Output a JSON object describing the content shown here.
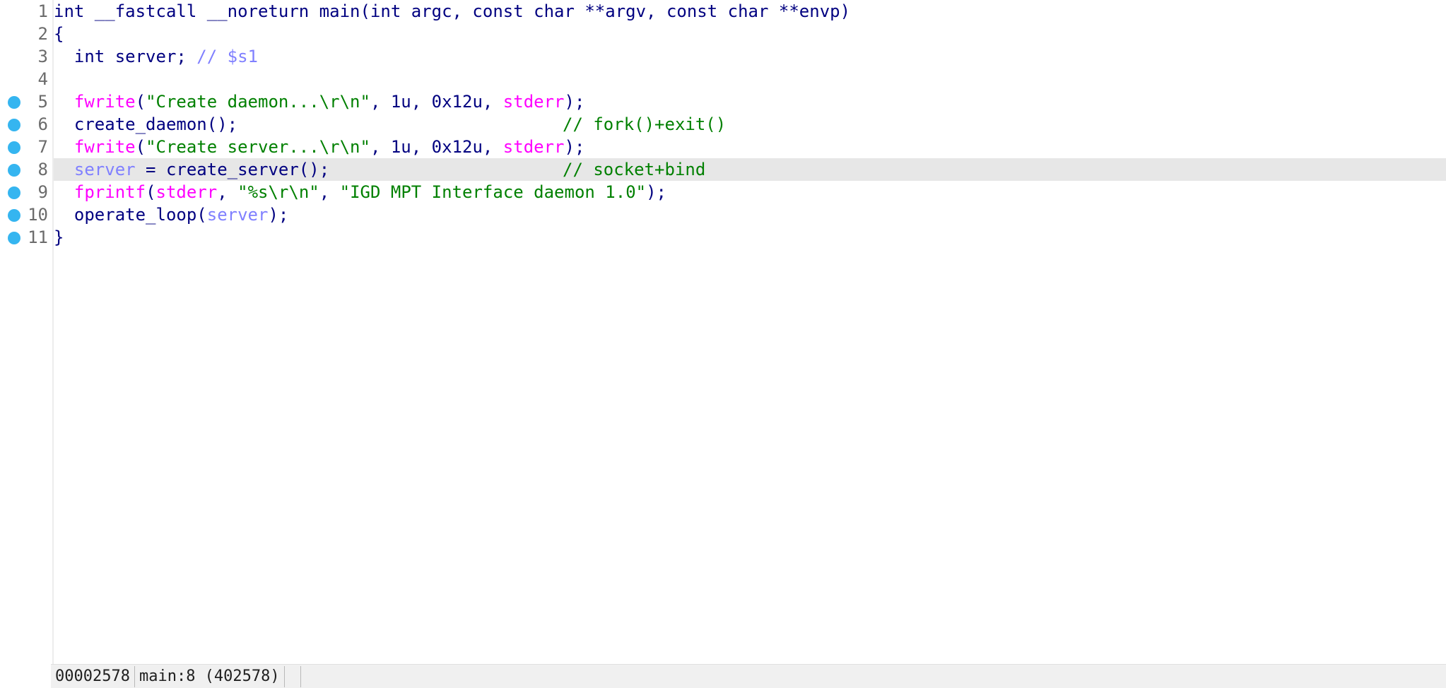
{
  "editor": {
    "lines": [
      {
        "num": "1",
        "breakpoint": false,
        "current": false,
        "code": [
          {
            "t": "int __fastcall __noreturn main(int argc, const char **argv, const char **envp)",
            "c": "default"
          }
        ],
        "comment": ""
      },
      {
        "num": "2",
        "breakpoint": false,
        "current": false,
        "code": [
          {
            "t": "{",
            "c": "default"
          }
        ],
        "comment": ""
      },
      {
        "num": "3",
        "breakpoint": false,
        "current": false,
        "code": [
          {
            "t": "  int server; ",
            "c": "default"
          },
          {
            "t": "// $s1",
            "c": "var"
          }
        ],
        "comment": ""
      },
      {
        "num": "4",
        "breakpoint": false,
        "current": false,
        "code": [],
        "comment": ""
      },
      {
        "num": "5",
        "breakpoint": true,
        "current": false,
        "code": [
          {
            "t": "  ",
            "c": "default"
          },
          {
            "t": "fwrite",
            "c": "func"
          },
          {
            "t": "(",
            "c": "punct"
          },
          {
            "t": "\"Create daemon...\\r\\n\"",
            "c": "str"
          },
          {
            "t": ", 1u, 0x12u, ",
            "c": "num"
          },
          {
            "t": "stderr",
            "c": "func"
          },
          {
            "t": ");",
            "c": "punct"
          }
        ],
        "comment": ""
      },
      {
        "num": "6",
        "breakpoint": true,
        "current": false,
        "code": [
          {
            "t": "  create_daemon();",
            "c": "ident"
          }
        ],
        "comment": "// fork()+exit()"
      },
      {
        "num": "7",
        "breakpoint": true,
        "current": false,
        "code": [
          {
            "t": "  ",
            "c": "default"
          },
          {
            "t": "fwrite",
            "c": "func"
          },
          {
            "t": "(",
            "c": "punct"
          },
          {
            "t": "\"Create server...\\r\\n\"",
            "c": "str"
          },
          {
            "t": ", 1u, 0x12u, ",
            "c": "num"
          },
          {
            "t": "stderr",
            "c": "func"
          },
          {
            "t": ");",
            "c": "punct"
          }
        ],
        "comment": ""
      },
      {
        "num": "8",
        "breakpoint": true,
        "current": true,
        "code": [
          {
            "t": "  ",
            "c": "default"
          },
          {
            "t": "server",
            "c": "var"
          },
          {
            "t": " = create_server();",
            "c": "ident"
          }
        ],
        "comment": "// socket+bind"
      },
      {
        "num": "9",
        "breakpoint": true,
        "current": false,
        "code": [
          {
            "t": "  ",
            "c": "default"
          },
          {
            "t": "fprintf",
            "c": "func"
          },
          {
            "t": "(",
            "c": "punct"
          },
          {
            "t": "stderr",
            "c": "func"
          },
          {
            "t": ", ",
            "c": "punct"
          },
          {
            "t": "\"%s\\r\\n\"",
            "c": "str"
          },
          {
            "t": ", ",
            "c": "punct"
          },
          {
            "t": "\"IGD MPT Interface daemon 1.0\"",
            "c": "str"
          },
          {
            "t": ");",
            "c": "punct"
          }
        ],
        "comment": ""
      },
      {
        "num": "10",
        "breakpoint": true,
        "current": false,
        "code": [
          {
            "t": "  operate_loop(",
            "c": "ident"
          },
          {
            "t": "server",
            "c": "var"
          },
          {
            "t": ");",
            "c": "punct"
          }
        ],
        "comment": ""
      },
      {
        "num": "11",
        "breakpoint": true,
        "current": false,
        "code": [
          {
            "t": "}",
            "c": "default"
          }
        ],
        "comment": ""
      }
    ]
  },
  "status_bar": {
    "address": "00002578",
    "location": "main:8 (402578)",
    "extra": ""
  },
  "colors": {
    "breakpoint": "#35b5f0",
    "current_line": "#e7e7e7",
    "keyword": "#000080",
    "function": "#ff00ff",
    "string": "#008000",
    "variable": "#8080ff",
    "comment": "#008000"
  }
}
